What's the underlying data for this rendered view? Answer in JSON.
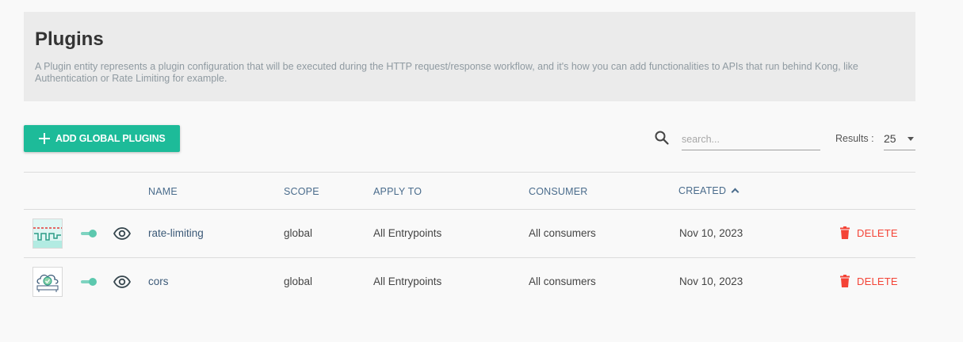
{
  "header": {
    "title": "Plugins",
    "description": "A Plugin entity represents a plugin configuration that will be executed during the HTTP request/response workflow, and it's how you can add functionalities to APIs that run behind Kong, like Authentication or Rate Limiting for example."
  },
  "toolbar": {
    "add_label": "ADD GLOBAL PLUGINS",
    "search_placeholder": "search...",
    "results_label": "Results :",
    "results_value": "25"
  },
  "table": {
    "columns": [
      "NAME",
      "SCOPE",
      "APPLY TO",
      "CONSUMER",
      "CREATED"
    ],
    "sort_column": "CREATED",
    "rows": [
      {
        "name": "rate-limiting",
        "scope": "global",
        "apply_to": "All Entrypoints",
        "consumer": "All consumers",
        "created": "Nov 10, 2023",
        "icon": "rate-limiting-icon",
        "enabled": true,
        "delete_label": "DELETE"
      },
      {
        "name": "cors",
        "scope": "global",
        "apply_to": "All Entrypoints",
        "consumer": "All consumers",
        "created": "Nov 10, 2023",
        "icon": "cors-icon",
        "enabled": true,
        "delete_label": "DELETE"
      }
    ]
  },
  "colors": {
    "accent": "#1dbb99",
    "toggle_on": "#5cc8ae",
    "delete": "#f44336",
    "link": "#3c5a78",
    "header_bg": "#ebebeb"
  }
}
